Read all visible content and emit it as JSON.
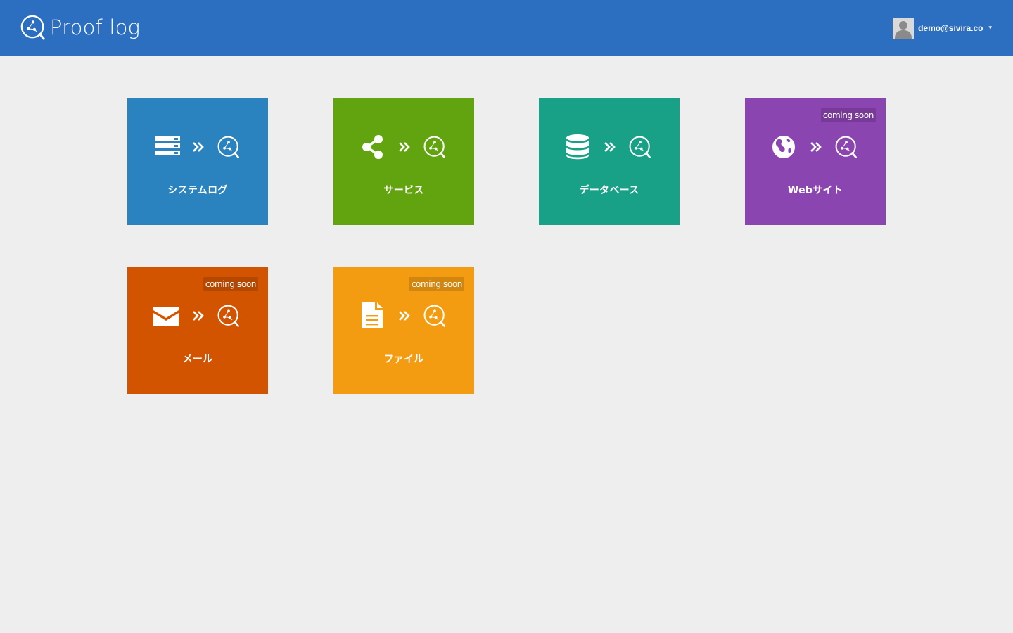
{
  "header": {
    "brand_name": "Proof log",
    "user_email": "demo@sivira.co",
    "caret": "▾",
    "bar_color": "#2c6fc1"
  },
  "tiles": [
    {
      "label": "システムログ",
      "icon": "server-icon",
      "color": "#2a82bf",
      "badge": ""
    },
    {
      "label": "サービス",
      "icon": "share-icon",
      "color": "#62a40f",
      "badge": ""
    },
    {
      "label": "データベース",
      "icon": "database-icon",
      "color": "#19a188",
      "badge": ""
    },
    {
      "label": "Webサイト",
      "icon": "globe-icon",
      "color": "#8b45b0",
      "badge": "coming soon"
    },
    {
      "label": "メール",
      "icon": "envelope-icon",
      "color": "#d35400",
      "badge": "coming soon"
    },
    {
      "label": "ファイル",
      "icon": "file-text-icon",
      "color": "#f39c12",
      "badge": "coming soon"
    }
  ]
}
